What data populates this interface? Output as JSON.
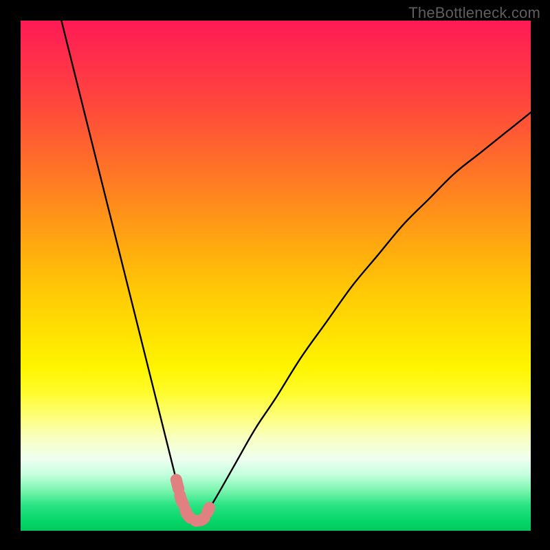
{
  "watermark": "TheBottleneck.com",
  "chart_data": {
    "type": "line",
    "title": "",
    "xlabel": "",
    "ylabel": "",
    "xlim": [
      0,
      100
    ],
    "ylim": [
      0,
      100
    ],
    "series": [
      {
        "name": "bottleneck-curve",
        "x": [
          8,
          10,
          12,
          14,
          16,
          18,
          20,
          22,
          24,
          26,
          28,
          30,
          31,
          32,
          33,
          34,
          35,
          36,
          38,
          42,
          46,
          50,
          55,
          60,
          65,
          70,
          75,
          80,
          85,
          90,
          95,
          100
        ],
        "y": [
          100,
          92,
          84,
          76,
          68,
          60,
          52,
          44,
          36,
          28,
          20,
          12,
          8,
          5,
          3,
          2,
          2,
          3,
          6,
          13,
          20,
          26,
          34,
          41,
          48,
          54,
          60,
          65,
          70,
          74,
          78,
          82
        ]
      }
    ],
    "highlight_segment": {
      "name": "salmon-highlight",
      "x": [
        30.5,
        31,
        31.5,
        32,
        32.5,
        33,
        33.5,
        34,
        35,
        36,
        37
      ],
      "y": [
        10,
        8,
        6,
        5,
        3.5,
        2.8,
        2.3,
        2.0,
        2.0,
        2.5,
        4.5
      ]
    },
    "colors": {
      "curve": "#000000",
      "highlight": "#e08080"
    }
  }
}
